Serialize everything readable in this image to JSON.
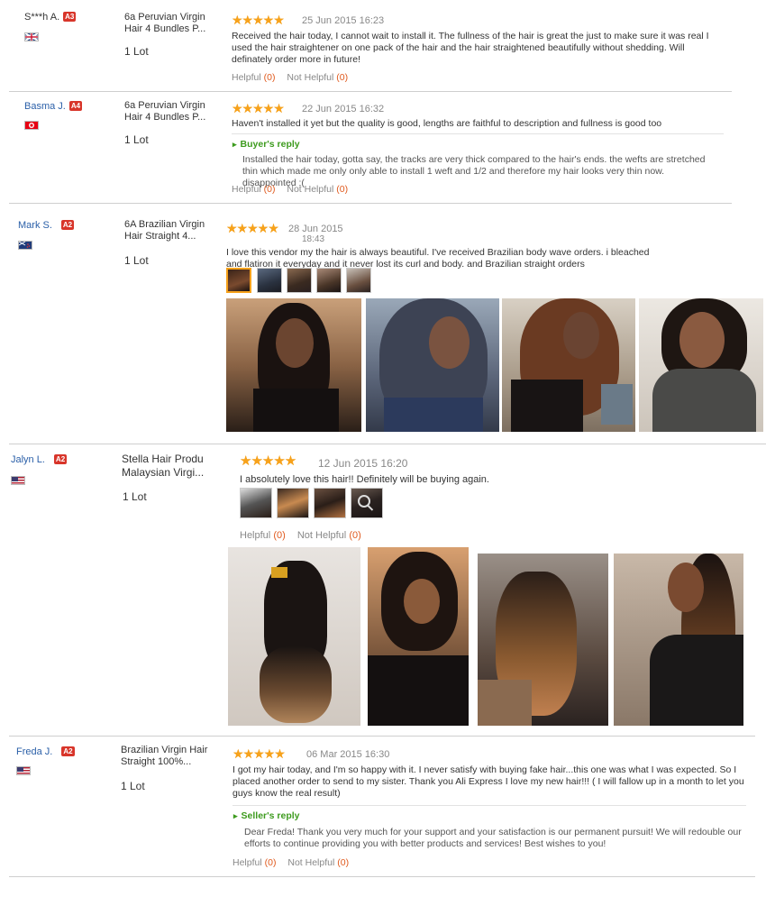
{
  "reviews": [
    {
      "author": "S***h A.",
      "level": "A3",
      "country": "gb",
      "product": "6a Peruvian Virgin Hair 4 Bundles P...",
      "quantity": "1 Lot",
      "stars": "★★★★★",
      "date": "25 Jun 2015 16:23",
      "text": "Received the hair today, I cannot wait to install it. The fullness of the hair is great the just to make sure it was real I used the hair straightener on one pack of the hair and the hair straightened beautifully without shedding. Will definately order more in future!",
      "helpful_label": "Helpful",
      "helpful_count": "(0)",
      "not_helpful_label": "Not Helpful",
      "not_helpful_count": "(0)"
    },
    {
      "author": "Basma J.",
      "level": "A4",
      "country": "tn",
      "product": "6a Peruvian Virgin Hair 4 Bundles P...",
      "quantity": "1 Lot",
      "stars": "★★★★★",
      "date": "22 Jun 2015 16:32",
      "text": "Haven't installed it yet but the quality is good, lengths are faithful to description and fullness is good too",
      "reply_title": "Buyer's reply",
      "reply_text": "Installed the hair today, gotta say, the tracks are very thick compared to the hair's ends. the wefts are stretched thin which made me only only able to install 1 weft and 1/2 and therefore my hair looks very thin now. disappointed :(",
      "helpful_label": "Helpful",
      "helpful_count": "(0)",
      "not_helpful_label": "Not Helpful",
      "not_helpful_count": "(0)"
    },
    {
      "author": "Mark S.",
      "level": "A2",
      "country": "nz",
      "product": "6A Brazilian Virgin Hair Straight 4...",
      "quantity": "1 Lot",
      "stars": "★★★★★",
      "date": "28 Jun 2015",
      "time": "18:43",
      "text": "I love this vendor my the hair is always beautiful. I've received Brazilian body wave orders. i bleached and flatiron it everyday and it never lost its curl and body. and Brazilian straight orders"
    },
    {
      "author": "Jalyn L.",
      "level": "A2",
      "country": "us",
      "product": "Stella Hair Produ Malaysian Virgi...",
      "quantity": "1 Lot",
      "stars": "★★★★★",
      "date": "12 Jun 2015 16:20",
      "text": "I absolutely love this hair!! Definitely will be buying again.",
      "helpful_label": "Helpful",
      "helpful_count": "(0)",
      "not_helpful_label": "Not Helpful",
      "not_helpful_count": "(0)"
    },
    {
      "author": "Freda J.",
      "level": "A2",
      "country": "us",
      "product": "Brazilian Virgin Hair Straight 100%...",
      "quantity": "1 Lot",
      "stars": "★★★★★",
      "date": "06 Mar 2015 16:30",
      "text": "I got my hair today, and I'm so happy with it. I never satisfy with buying fake hair...this one was what I was expected. So I placed another order to send to my sister. Thank you Ali Express I love my new hair!!! ( I will fallow up in a month to let you guys know the real result)",
      "reply_title": "Seller's reply",
      "reply_text": "Dear Freda! Thank you very much for your support and your satisfaction is our permanent pursuit! We will redouble our efforts to continue providing you with better products and services! Best wishes to you!",
      "helpful_label": "Helpful",
      "helpful_count": "(0)",
      "not_helpful_label": "Not Helpful",
      "not_helpful_count": "(0)"
    }
  ],
  "colors": {
    "link": "#2a5fa8",
    "badge": "#d8352a",
    "star": "#f7a21b",
    "reply": "#3d9b1e",
    "count": "#e05a1e"
  }
}
